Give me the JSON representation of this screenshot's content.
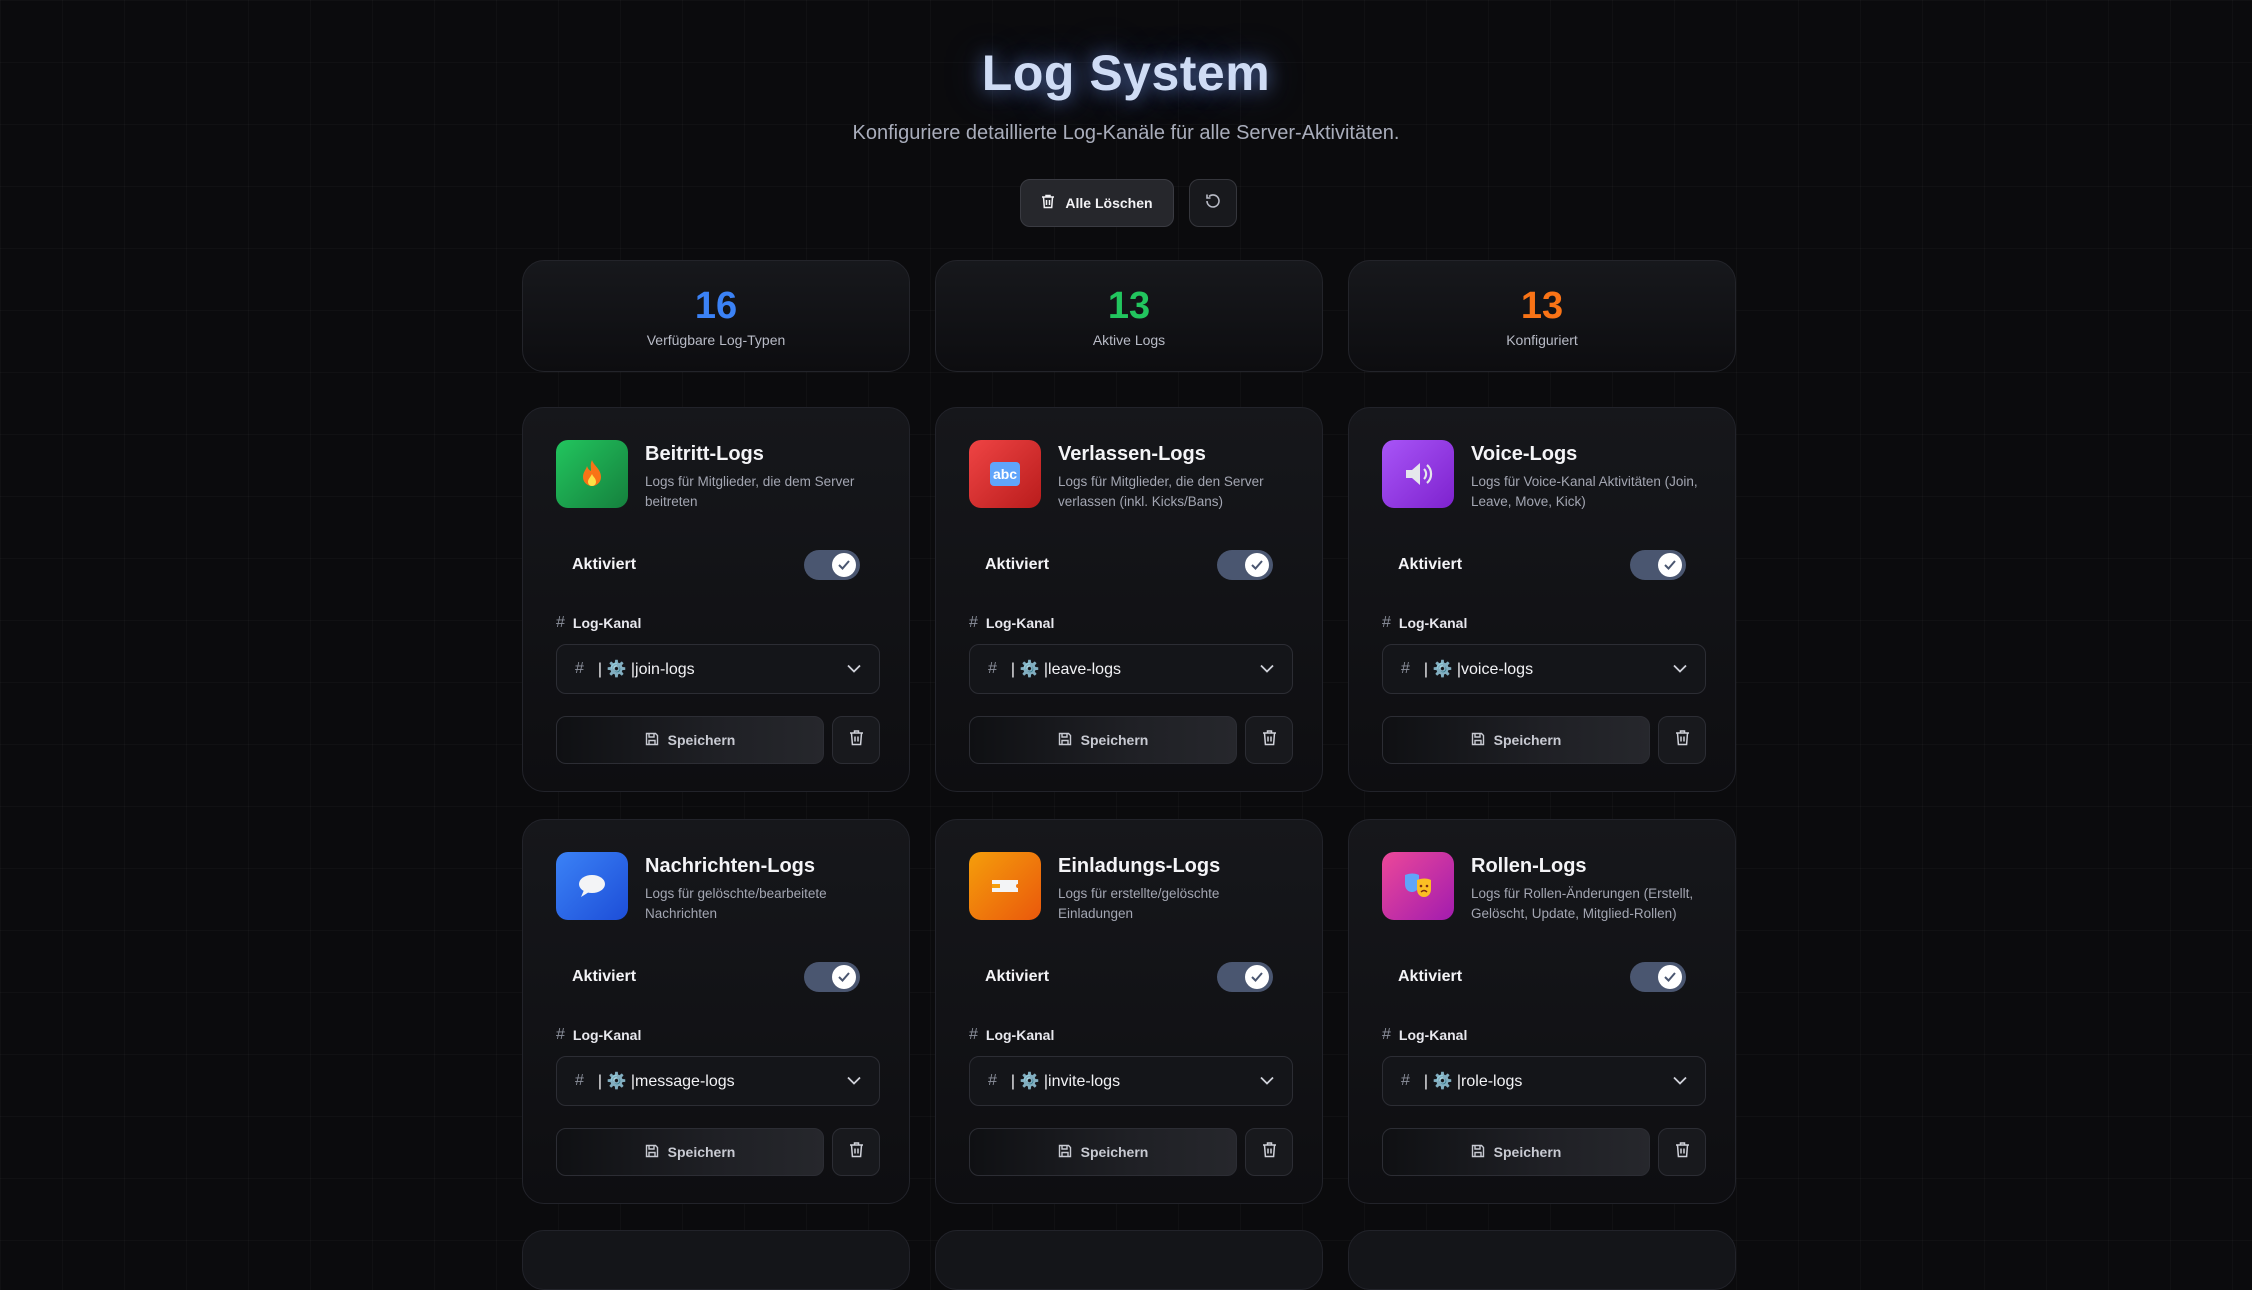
{
  "header": {
    "title": "Log System",
    "subtitle": "Konfiguriere detaillierte Log-Kanäle für alle Server-Aktivitäten.",
    "delete_all_label": "Alle Löschen"
  },
  "stats": [
    {
      "value": "16",
      "label": "Verfügbare Log-Typen",
      "color": "#3b82f6"
    },
    {
      "value": "13",
      "label": "Aktive Logs",
      "color": "#22c55e"
    },
    {
      "value": "13",
      "label": "Konfiguriert",
      "color": "#f97316"
    }
  ],
  "common": {
    "enabled_label": "Aktiviert",
    "channel_label": "Log-Kanal",
    "save_label": "Speichern"
  },
  "cards": [
    {
      "title": "Beitritt-Logs",
      "desc": "Logs für Mitglieder, die dem Server beitreten",
      "channel": "| ⚙️ |join-logs",
      "icon": "fire-icon",
      "color": "#16a34a",
      "enabled": true
    },
    {
      "title": "Verlassen-Logs",
      "desc": "Logs für Mitglieder, die den Server verlassen (inkl. Kicks/Bans)",
      "channel": "| ⚙️ |leave-logs",
      "icon": "abc-icon",
      "color": "#dc2626",
      "enabled": true
    },
    {
      "title": "Voice-Logs",
      "desc": "Logs für Voice-Kanal Aktivitäten (Join, Leave, Move, Kick)",
      "channel": "| ⚙️ |voice-logs",
      "icon": "speaker-icon",
      "color": "#9333ea",
      "enabled": true
    },
    {
      "title": "Nachrichten-Logs",
      "desc": "Logs für gelöschte/bearbeitete Nachrichten",
      "channel": "| ⚙️ |message-logs",
      "icon": "speech-bubble-icon",
      "color": "#2563eb",
      "enabled": true
    },
    {
      "title": "Einladungs-Logs",
      "desc": "Logs für erstellte/gelöschte Einladungen",
      "channel": "| ⚙️ |invite-logs",
      "icon": "ticket-icon",
      "color": "#d97706",
      "enabled": true
    },
    {
      "title": "Rollen-Logs",
      "desc": "Logs für Rollen-Änderungen (Erstellt, Gelöscht, Update, Mitglied-Rollen)",
      "channel": "| ⚙️ |role-logs",
      "icon": "theater-masks-icon",
      "color": "#db2777",
      "enabled": true
    }
  ]
}
